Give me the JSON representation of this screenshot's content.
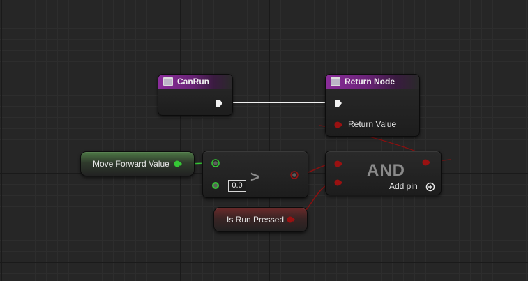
{
  "graph": {
    "entry_node": {
      "title": "CanRun",
      "icon": "function-icon"
    },
    "return_node": {
      "title": "Return Node",
      "icon": "function-icon",
      "output_label": "Return Value"
    },
    "move_forward_node": {
      "label": "Move Forward Value"
    },
    "greater_node": {
      "operator": ">",
      "default_value": "0.0"
    },
    "is_run_pressed_node": {
      "label": "Is Run Pressed"
    },
    "and_node": {
      "title": "AND",
      "add_pin_label": "Add pin"
    },
    "colors": {
      "exec": "#ffffff",
      "float": "#35c735",
      "bool": "#9a1111",
      "function_header": "#7a2a8a"
    }
  }
}
